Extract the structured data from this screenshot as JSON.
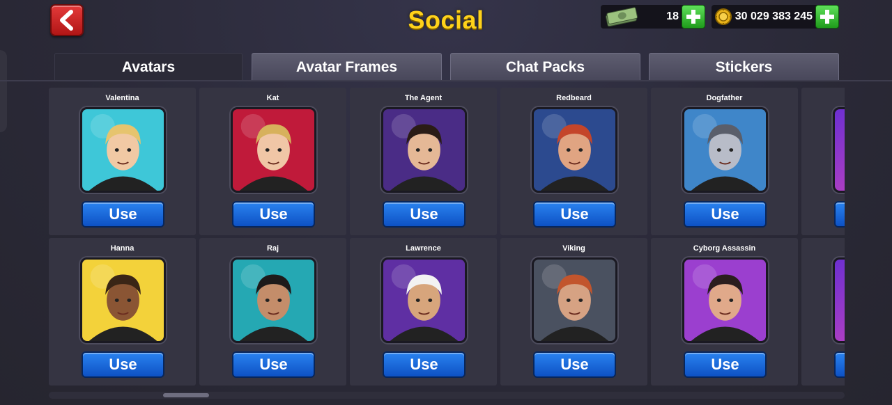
{
  "header": {
    "title": "Social",
    "back_icon": "chevron-left-icon",
    "cash": "18",
    "coins": "30 029 383 245"
  },
  "tabs": [
    {
      "label": "Avatars",
      "active": true
    },
    {
      "label": "Avatar Frames",
      "active": false
    },
    {
      "label": "Chat Packs",
      "active": false
    },
    {
      "label": "Stickers",
      "active": false
    }
  ],
  "avatars": [
    {
      "name": "Valentina",
      "button": "Use",
      "bg": "#3ec7d8",
      "skin": "#f1c9a4",
      "hair": "#e6c46e"
    },
    {
      "name": "Kat",
      "button": "Use",
      "bg": "#c01a3a",
      "skin": "#f0c6a6",
      "hair": "#d7b15c"
    },
    {
      "name": "The Agent",
      "button": "Use",
      "bg": "#4a2c86",
      "skin": "#e5b896",
      "hair": "#2a1c16"
    },
    {
      "name": "Redbeard",
      "button": "Use",
      "bg": "#2c4a8f",
      "skin": "#e0a482",
      "hair": "#c4452a"
    },
    {
      "name": "Dogfather",
      "button": "Use",
      "bg": "#3f86c9",
      "skin": "#b8bcc8",
      "hair": "#5a5e6a"
    },
    {
      "name": "Hanna",
      "button": "Use",
      "bg": "#f3d23a",
      "skin": "#8a5534",
      "hair": "#3a2516"
    },
    {
      "name": "Raj",
      "button": "Use",
      "bg": "#25a8b3",
      "skin": "#c48d6a",
      "hair": "#1e1a1a"
    },
    {
      "name": "Lawrence",
      "button": "Use",
      "bg": "#5f2fa3",
      "skin": "#d7a57c",
      "hair": "#f2f2f2"
    },
    {
      "name": "Viking",
      "button": "Use",
      "bg": "#4a5160",
      "skin": "#d6a283",
      "hair": "#c2552d"
    },
    {
      "name": "Cyborg Assassin",
      "button": "Use",
      "bg": "#9b3fcf",
      "skin": "#e0a98a",
      "hair": "#2a1e1e"
    }
  ],
  "colors": {
    "title": "#ffd21a",
    "use_button": "#1f6fe0",
    "plus_button": "#3cc236",
    "back_button": "#d42626"
  }
}
